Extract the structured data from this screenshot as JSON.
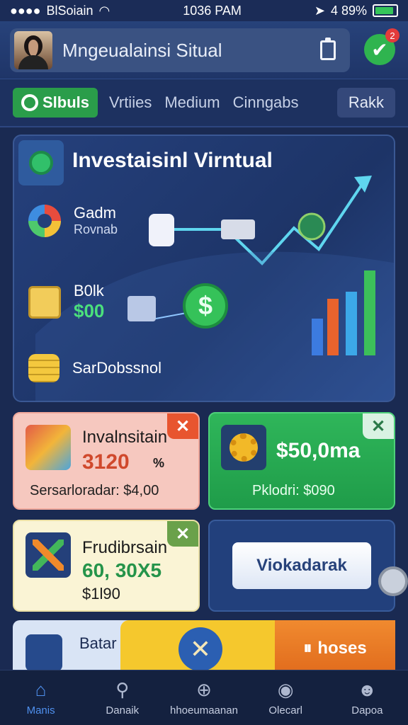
{
  "status_bar": {
    "carrier": "BlSoiain",
    "time": "1036 PAM",
    "battery": "4 89%",
    "battery_level": 0.89
  },
  "header": {
    "title": "Mngeualainsi Situal",
    "notification_count": "2"
  },
  "tabs": [
    {
      "label": "Slbuls"
    },
    {
      "label": "Vrtiies"
    },
    {
      "label": "Medium"
    },
    {
      "label": "Cinngabs"
    },
    {
      "label": "Rakk"
    }
  ],
  "hero": {
    "title": "Investaisinl Virntual",
    "rows": [
      {
        "label": "Gadm",
        "sub": "Rovnab"
      },
      {
        "label": "B0lk",
        "value": "$00"
      },
      {
        "label": "SarDobssnol"
      }
    ]
  },
  "cards": {
    "card1": {
      "title": "Invalnsitain",
      "value": "3120",
      "badge": "%",
      "footer": "Sersarloradar: $4,00"
    },
    "card2": {
      "value": "$50,0ma",
      "footer": "Pklodri: $090"
    },
    "card3": {
      "title": "Frudibrsain",
      "value": "60, 30X5",
      "footer": "$1l90"
    },
    "card4": {
      "button_label": "Viokadarak"
    }
  },
  "banner": {
    "left_label": "Batar",
    "right_label": "hoses"
  },
  "nav": [
    {
      "label": "Manis",
      "icon": "home-icon"
    },
    {
      "label": "Danaik",
      "icon": "search-icon"
    },
    {
      "label": "hhoeumaanan",
      "icon": "lock-icon"
    },
    {
      "label": "Olecarl",
      "icon": "magnify-icon"
    },
    {
      "label": "Dapoa",
      "icon": "profile-icon"
    }
  ],
  "colors": {
    "accent": "#2fb44f",
    "background": "#1a2a52",
    "primary_blue": "#2b5fb2"
  }
}
